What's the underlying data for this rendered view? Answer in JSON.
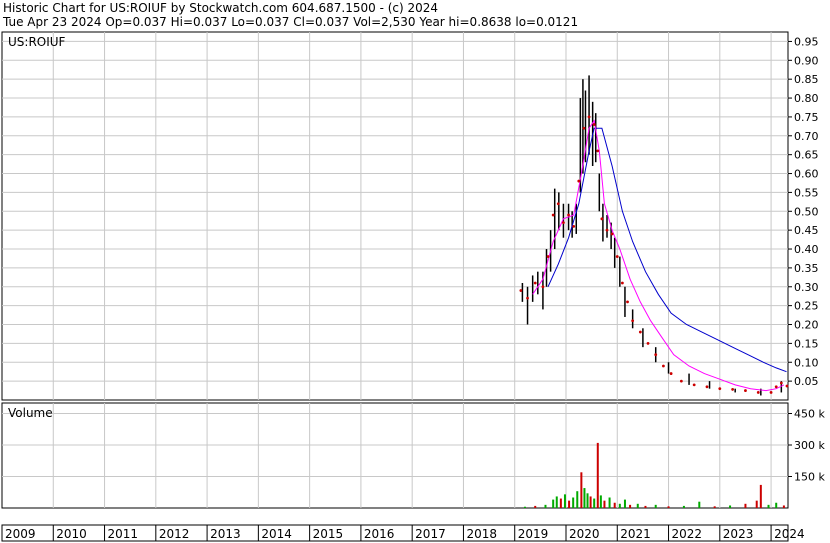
{
  "header": {
    "line1": "Historic Chart for US:ROIUF by Stockwatch.com 604.687.1500 - (c) 2024",
    "line2": "Tue Apr 23 2024   Op=0.037   Hi=0.037   Lo=0.037   Cl=0.037   Vol=2,530   Year hi=0.8638   lo=0.0121"
  },
  "chart_data": [
    {
      "type": "line",
      "title": "US:ROIUF",
      "ylim": [
        0,
        0.975
      ],
      "y_ticks": [
        {
          "v": 0.05,
          "label": "0.05"
        },
        {
          "v": 0.1,
          "label": "0.10"
        },
        {
          "v": 0.15,
          "label": "0.15"
        },
        {
          "v": 0.2,
          "label": "0.20"
        },
        {
          "v": 0.25,
          "label": "0.25"
        },
        {
          "v": 0.3,
          "label": "0.30"
        },
        {
          "v": 0.35,
          "label": "0.35"
        },
        {
          "v": 0.4,
          "label": "0.40"
        },
        {
          "v": 0.45,
          "label": "0.45"
        },
        {
          "v": 0.5,
          "label": "0.50"
        },
        {
          "v": 0.55,
          "label": "0.55"
        },
        {
          "v": 0.6,
          "label": "0.60"
        },
        {
          "v": 0.65,
          "label": "0.65"
        },
        {
          "v": 0.7,
          "label": "0.70"
        },
        {
          "v": 0.75,
          "label": "0.75"
        },
        {
          "v": 0.8,
          "label": "0.80"
        },
        {
          "v": 0.85,
          "label": "0.85"
        },
        {
          "v": 0.9,
          "label": "0.90"
        },
        {
          "v": 0.95,
          "label": "0.95"
        }
      ],
      "grid": true,
      "colors": {
        "price_bar": "#000000",
        "close_dot": "#cc0000",
        "ma_short": "#ff00ff",
        "ma_long": "#0000cc"
      },
      "price_bars": [
        {
          "x": 2019.15,
          "lo": 0.26,
          "hi": 0.31
        },
        {
          "x": 2019.25,
          "lo": 0.2,
          "hi": 0.3
        },
        {
          "x": 2019.35,
          "lo": 0.26,
          "hi": 0.33
        },
        {
          "x": 2019.45,
          "lo": 0.28,
          "hi": 0.34
        },
        {
          "x": 2019.55,
          "lo": 0.24,
          "hi": 0.34
        },
        {
          "x": 2019.62,
          "lo": 0.3,
          "hi": 0.4
        },
        {
          "x": 2019.7,
          "lo": 0.34,
          "hi": 0.45
        },
        {
          "x": 2019.78,
          "lo": 0.4,
          "hi": 0.56
        },
        {
          "x": 2019.86,
          "lo": 0.45,
          "hi": 0.55
        },
        {
          "x": 2019.95,
          "lo": 0.43,
          "hi": 0.52
        },
        {
          "x": 2020.05,
          "lo": 0.45,
          "hi": 0.52
        },
        {
          "x": 2020.12,
          "lo": 0.43,
          "hi": 0.5
        },
        {
          "x": 2020.2,
          "lo": 0.44,
          "hi": 0.52
        },
        {
          "x": 2020.28,
          "lo": 0.55,
          "hi": 0.8
        },
        {
          "x": 2020.33,
          "lo": 0.6,
          "hi": 0.85
        },
        {
          "x": 2020.38,
          "lo": 0.63,
          "hi": 0.82
        },
        {
          "x": 2020.45,
          "lo": 0.65,
          "hi": 0.86
        },
        {
          "x": 2020.52,
          "lo": 0.62,
          "hi": 0.79
        },
        {
          "x": 2020.58,
          "lo": 0.63,
          "hi": 0.76
        },
        {
          "x": 2020.65,
          "lo": 0.5,
          "hi": 0.6
        },
        {
          "x": 2020.72,
          "lo": 0.42,
          "hi": 0.52
        },
        {
          "x": 2020.8,
          "lo": 0.43,
          "hi": 0.49
        },
        {
          "x": 2020.88,
          "lo": 0.4,
          "hi": 0.47
        },
        {
          "x": 2020.95,
          "lo": 0.35,
          "hi": 0.43
        },
        {
          "x": 2021.05,
          "lo": 0.3,
          "hi": 0.38
        },
        {
          "x": 2021.15,
          "lo": 0.22,
          "hi": 0.3
        },
        {
          "x": 2021.3,
          "lo": 0.19,
          "hi": 0.24
        },
        {
          "x": 2021.5,
          "lo": 0.14,
          "hi": 0.19
        },
        {
          "x": 2021.75,
          "lo": 0.1,
          "hi": 0.14
        },
        {
          "x": 2022.0,
          "lo": 0.07,
          "hi": 0.1
        },
        {
          "x": 2022.4,
          "lo": 0.04,
          "hi": 0.07
        },
        {
          "x": 2022.8,
          "lo": 0.03,
          "hi": 0.05
        },
        {
          "x": 2023.3,
          "lo": 0.02,
          "hi": 0.03
        },
        {
          "x": 2023.8,
          "lo": 0.012,
          "hi": 0.03
        },
        {
          "x": 2024.2,
          "lo": 0.02,
          "hi": 0.05
        }
      ],
      "close_series": {
        "x": [
          2019.12,
          2019.25,
          2019.4,
          2019.55,
          2019.65,
          2019.75,
          2019.85,
          2019.95,
          2020.05,
          2020.15,
          2020.25,
          2020.35,
          2020.45,
          2020.55,
          2020.62,
          2020.7,
          2020.8,
          2020.9,
          2021.0,
          2021.1,
          2021.2,
          2021.3,
          2021.45,
          2021.6,
          2021.75,
          2021.9,
          2022.05,
          2022.25,
          2022.5,
          2022.75,
          2023.0,
          2023.25,
          2023.5,
          2023.75,
          2024.0,
          2024.1,
          2024.2,
          2024.31
        ],
        "y": [
          0.29,
          0.27,
          0.31,
          0.3,
          0.38,
          0.49,
          0.52,
          0.47,
          0.49,
          0.46,
          0.58,
          0.72,
          0.75,
          0.73,
          0.66,
          0.48,
          0.45,
          0.44,
          0.38,
          0.31,
          0.26,
          0.21,
          0.18,
          0.15,
          0.12,
          0.09,
          0.07,
          0.05,
          0.04,
          0.035,
          0.03,
          0.028,
          0.025,
          0.02,
          0.02,
          0.035,
          0.045,
          0.037
        ]
      },
      "ma_short": {
        "x": [
          2019.35,
          2019.55,
          2019.75,
          2019.95,
          2020.15,
          2020.3,
          2020.45,
          2020.55,
          2020.65,
          2020.75,
          2020.9,
          2021.05,
          2021.25,
          2021.45,
          2021.65,
          2021.85,
          2022.1,
          2022.4,
          2022.7,
          2023.0,
          2023.3,
          2023.6,
          2023.9,
          2024.1,
          2024.25
        ],
        "y": [
          0.28,
          0.32,
          0.42,
          0.48,
          0.49,
          0.6,
          0.72,
          0.74,
          0.66,
          0.52,
          0.45,
          0.4,
          0.32,
          0.26,
          0.21,
          0.17,
          0.12,
          0.09,
          0.07,
          0.055,
          0.04,
          0.03,
          0.025,
          0.03,
          0.04
        ]
      },
      "ma_long": {
        "x": [
          2019.65,
          2019.85,
          2020.05,
          2020.25,
          2020.45,
          2020.55,
          2020.7,
          2020.9,
          2021.1,
          2021.3,
          2021.55,
          2021.8,
          2022.05,
          2022.35,
          2022.65,
          2022.95,
          2023.25,
          2023.55,
          2023.85,
          2024.1,
          2024.3
        ],
        "y": [
          0.3,
          0.36,
          0.43,
          0.52,
          0.66,
          0.72,
          0.72,
          0.62,
          0.5,
          0.42,
          0.34,
          0.28,
          0.23,
          0.2,
          0.18,
          0.16,
          0.14,
          0.12,
          0.1,
          0.085,
          0.075
        ]
      }
    },
    {
      "type": "bar",
      "title": "Volume",
      "ylim": [
        0,
        500000
      ],
      "y_ticks": [
        {
          "v": 150000,
          "label": "150 k"
        },
        {
          "v": 300000,
          "label": "300 k"
        },
        {
          "v": 450000,
          "label": "450 k"
        }
      ],
      "grid": true,
      "colors": {
        "up": "#00aa00",
        "down": "#cc0000"
      },
      "bars": [
        {
          "x": 2019.2,
          "v": 6000,
          "c": "up"
        },
        {
          "x": 2019.4,
          "v": 10000,
          "c": "down"
        },
        {
          "x": 2019.6,
          "v": 15000,
          "c": "up"
        },
        {
          "x": 2019.75,
          "v": 40000,
          "c": "up"
        },
        {
          "x": 2019.82,
          "v": 55000,
          "c": "up"
        },
        {
          "x": 2019.9,
          "v": 45000,
          "c": "down"
        },
        {
          "x": 2019.98,
          "v": 65000,
          "c": "up"
        },
        {
          "x": 2020.06,
          "v": 35000,
          "c": "down"
        },
        {
          "x": 2020.14,
          "v": 50000,
          "c": "up"
        },
        {
          "x": 2020.22,
          "v": 80000,
          "c": "up"
        },
        {
          "x": 2020.3,
          "v": 170000,
          "c": "down"
        },
        {
          "x": 2020.36,
          "v": 95000,
          "c": "up"
        },
        {
          "x": 2020.42,
          "v": 70000,
          "c": "up"
        },
        {
          "x": 2020.48,
          "v": 55000,
          "c": "down"
        },
        {
          "x": 2020.55,
          "v": 45000,
          "c": "up"
        },
        {
          "x": 2020.62,
          "v": 310000,
          "c": "down"
        },
        {
          "x": 2020.68,
          "v": 60000,
          "c": "up"
        },
        {
          "x": 2020.75,
          "v": 35000,
          "c": "down"
        },
        {
          "x": 2020.85,
          "v": 50000,
          "c": "up"
        },
        {
          "x": 2020.95,
          "v": 25000,
          "c": "down"
        },
        {
          "x": 2021.05,
          "v": 20000,
          "c": "up"
        },
        {
          "x": 2021.15,
          "v": 40000,
          "c": "up"
        },
        {
          "x": 2021.25,
          "v": 15000,
          "c": "down"
        },
        {
          "x": 2021.4,
          "v": 20000,
          "c": "up"
        },
        {
          "x": 2021.55,
          "v": 10000,
          "c": "down"
        },
        {
          "x": 2021.75,
          "v": 15000,
          "c": "up"
        },
        {
          "x": 2022.0,
          "v": 8000,
          "c": "down"
        },
        {
          "x": 2022.3,
          "v": 10000,
          "c": "up"
        },
        {
          "x": 2022.6,
          "v": 30000,
          "c": "up"
        },
        {
          "x": 2022.9,
          "v": 8000,
          "c": "down"
        },
        {
          "x": 2023.2,
          "v": 12000,
          "c": "up"
        },
        {
          "x": 2023.5,
          "v": 20000,
          "c": "down"
        },
        {
          "x": 2023.72,
          "v": 35000,
          "c": "down"
        },
        {
          "x": 2023.8,
          "v": 110000,
          "c": "down"
        },
        {
          "x": 2023.95,
          "v": 15000,
          "c": "up"
        },
        {
          "x": 2024.1,
          "v": 25000,
          "c": "up"
        },
        {
          "x": 2024.25,
          "v": 12000,
          "c": "down"
        }
      ]
    }
  ],
  "x_axis": {
    "xlim": [
      2009,
      2024.33
    ],
    "years": [
      "2009",
      "2010",
      "2011",
      "2012",
      "2013",
      "2014",
      "2015",
      "2016",
      "2017",
      "2018",
      "2019",
      "2020",
      "2021",
      "2022",
      "2023",
      "2024"
    ]
  }
}
